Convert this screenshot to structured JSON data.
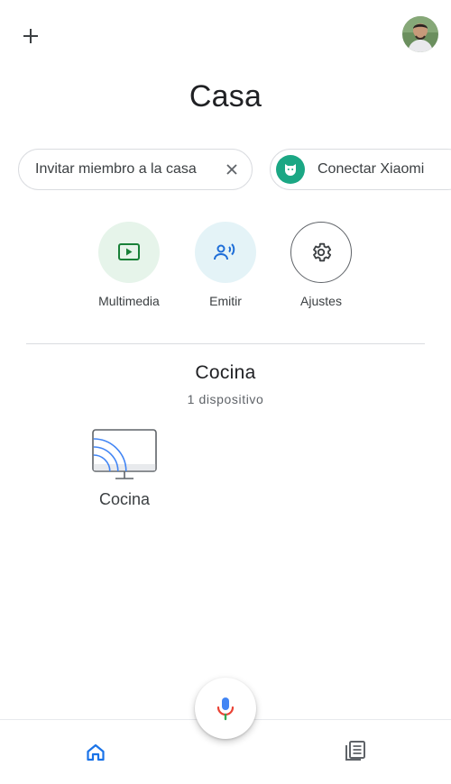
{
  "header": {
    "title": "Casa",
    "add_icon": "plus-icon",
    "avatar_icon": "user-avatar"
  },
  "chips": {
    "invite_label": "Invitar miembro a la casa",
    "xiaomi_label": "Conectar Xiaomi"
  },
  "actions": [
    {
      "label": "Multimedia",
      "icon": "play-icon"
    },
    {
      "label": "Emitir",
      "icon": "cast-voice-icon"
    },
    {
      "label": "Ajustes",
      "icon": "gear-icon"
    }
  ],
  "room": {
    "name": "Cocina",
    "device_count": "1 dispositivo"
  },
  "devices": [
    {
      "label": "Cocina",
      "icon": "cast-display-icon"
    }
  ],
  "bottom_nav": {
    "home_icon": "home-icon",
    "feed_icon": "feed-icon",
    "mic_icon": "mic-icon"
  },
  "colors": {
    "accent_blue": "#1a73e8",
    "multimedia_green": "#188038",
    "emit_blue": "#1e6ed8",
    "xiaomi_green": "#1ba784"
  }
}
